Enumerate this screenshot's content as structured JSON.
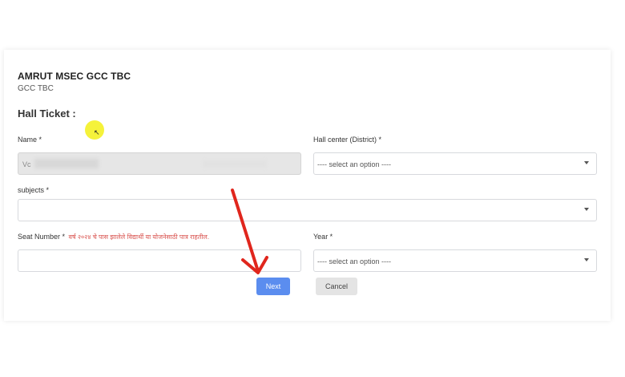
{
  "header": {
    "title": "AMRUT MSEC GCC TBC",
    "subtitle": "GCC TBC"
  },
  "section_title": "Hall Ticket :",
  "form": {
    "name_label": "Name *",
    "name_value": "Vc",
    "hall_center_label": "Hall center (District) *",
    "hall_center_placeholder": "---- select an option ----",
    "subjects_label": "subjects *",
    "seat_label": "Seat Number *",
    "seat_note": "वर्ष २०२४ चे पास झालेले विद्यार्थी या योजनेसाठी पात्र राहतील.",
    "year_label": "Year *",
    "year_placeholder": "---- select an option ----"
  },
  "buttons": {
    "next_label": "Next",
    "cancel_label": "Cancel"
  },
  "colors": {
    "accent": "#5b8def",
    "annotation_arrow": "#e0261d",
    "cursor_highlight": "#f3f017",
    "note_text": "#d9534f"
  }
}
